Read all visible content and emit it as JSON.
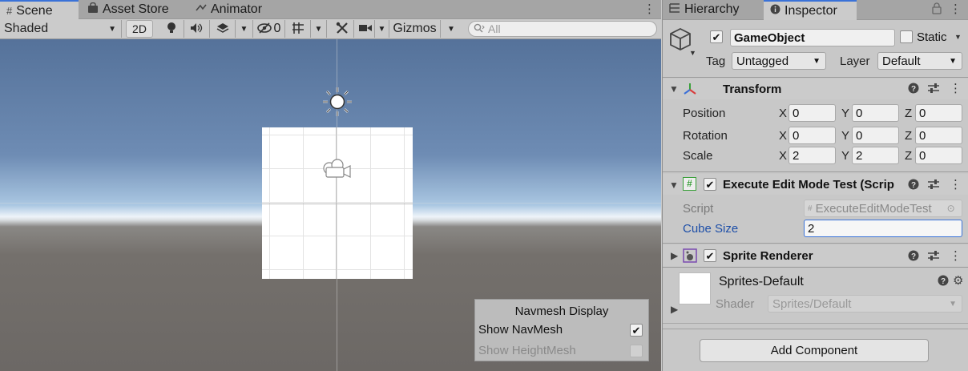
{
  "scene_tabs": [
    {
      "label": "Scene",
      "icon": "grid-icon"
    },
    {
      "label": "Asset Store",
      "icon": "shopping-bag-icon"
    },
    {
      "label": "Animator",
      "icon": "animator-icon"
    }
  ],
  "toolbar": {
    "draw_mode": "Shaded",
    "mode_2d": "2D",
    "hidden_count": "0",
    "gizmos": "Gizmos",
    "search_placeholder": "All"
  },
  "navmesh": {
    "title": "Navmesh Display",
    "show_navmesh": "Show NavMesh",
    "show_navmesh_checked": true,
    "show_heightmesh": "Show HeightMesh",
    "show_heightmesh_checked": false
  },
  "inspector_tabs": [
    {
      "label": "Hierarchy",
      "icon": "hierarchy-icon"
    },
    {
      "label": "Inspector",
      "icon": "info-icon"
    }
  ],
  "gameobject": {
    "name": "GameObject",
    "active": true,
    "static_label": "Static",
    "tag_label": "Tag",
    "tag_value": "Untagged",
    "layer_label": "Layer",
    "layer_value": "Default"
  },
  "transform": {
    "title": "Transform",
    "rows": [
      {
        "label": "Position",
        "x": "0",
        "y": "0",
        "z": "0"
      },
      {
        "label": "Rotation",
        "x": "0",
        "y": "0",
        "z": "0"
      },
      {
        "label": "Scale",
        "x": "2",
        "y": "2",
        "z": "0"
      }
    ],
    "axis": {
      "x": "X",
      "y": "Y",
      "z": "Z"
    }
  },
  "script_component": {
    "title": "Execute Edit Mode Test (Scrip",
    "script_label": "Script",
    "script_value": "ExecuteEditModeTest",
    "cube_size_label": "Cube Size",
    "cube_size_value": "2"
  },
  "sprite_renderer": {
    "title": "Sprite Renderer"
  },
  "material": {
    "name": "Sprites-Default",
    "shader_label": "Shader",
    "shader_value": "Sprites/Default"
  },
  "add_component": "Add Component",
  "colors": {
    "accent": "#3a72d8",
    "label_blue": "#1e4fa8"
  }
}
